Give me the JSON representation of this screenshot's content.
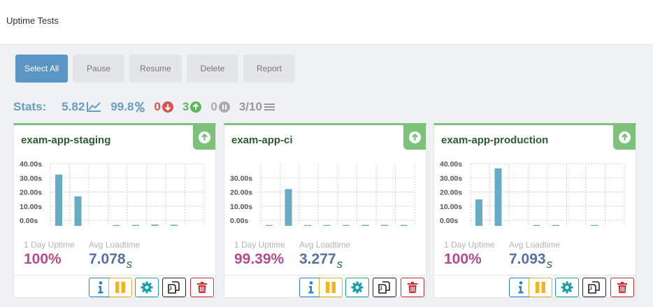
{
  "page": {
    "title": "Uptime Tests"
  },
  "toolbar": {
    "select_all": "Select All",
    "pause": "Pause",
    "resume": "Resume",
    "delete": "Delete",
    "report": "Report"
  },
  "stats": {
    "label": "Stats:",
    "avg_loadtime": "5.82",
    "avg_uptime": "99.8",
    "down": "0",
    "up": "3",
    "paused": "0",
    "total": "3/10",
    "colors": {
      "label": "#6a9cc4",
      "down": "#d9534f",
      "up": "#5cb85c",
      "paused": "#aaaaaa",
      "total": "#999999"
    }
  },
  "metrics_labels": {
    "uptime": "1 Day Uptime",
    "loadtime": "Avg Loadtime",
    "unit": "s"
  },
  "cards": [
    {
      "name": "exam-app-staging",
      "status": "up",
      "uptime": "100%",
      "loadtime": "7.078",
      "chart_data": {
        "type": "bar",
        "y_ticks": [
          "40.00s",
          "30.00s",
          "20.00s",
          "10.00s",
          "0.00s"
        ],
        "ylim": [
          0,
          40
        ],
        "values": [
          33,
          19,
          0,
          0.5,
          0.6,
          0.8,
          0.7,
          0
        ]
      }
    },
    {
      "name": "exam-app-ci",
      "status": "up",
      "uptime": "99.39%",
      "loadtime": "3.277",
      "chart_data": {
        "type": "bar",
        "y_ticks": [
          "30.00s",
          "20.00s",
          "10.00s",
          "0.00s"
        ],
        "ylim": [
          0,
          30
        ],
        "values": [
          0.5,
          23,
          0.3,
          0.4,
          0.3,
          0.6,
          0.6,
          0.6
        ]
      }
    },
    {
      "name": "exam-app-production",
      "status": "up",
      "uptime": "100%",
      "loadtime": "7.093",
      "chart_data": {
        "type": "bar",
        "y_ticks": [
          "40.00s",
          "30.00s",
          "20.00s",
          "10.00s",
          "0.00s"
        ],
        "ylim": [
          0,
          40
        ],
        "values": [
          17,
          37,
          0,
          0.4,
          0.5,
          0,
          0.5,
          0
        ]
      }
    }
  ],
  "icons": {
    "info": "info-icon",
    "pause": "pause-icon",
    "settings": "gear-icon",
    "copy": "copy-icon",
    "delete": "trash-icon",
    "status": "arrow-up-circle-icon"
  },
  "colors": {
    "accent": "#5a95c4",
    "up_green": "#7dc27a",
    "bar": "#67abc7",
    "uptime": "#b44b8e",
    "loadtime": "#5672a3"
  }
}
